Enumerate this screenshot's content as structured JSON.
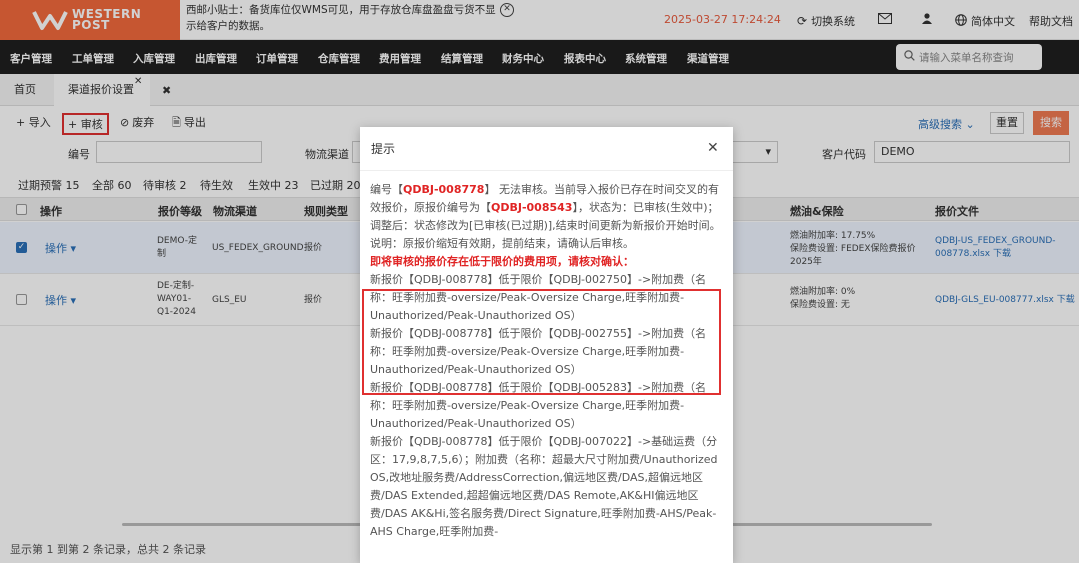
{
  "brand": {
    "logo_line1": "WESTERN",
    "logo_line2": "POST"
  },
  "header": {
    "tip": "西邮小贴士：备货库位仅WMS可见，用于存放仓库盘盈盘亏货不显示给客户的数据。",
    "datetime": "2025-03-27 17:24:24",
    "switch_system": "切换系统",
    "language": "简体中文",
    "help": "帮助文档"
  },
  "nav": {
    "items": [
      "客户管理",
      "工单管理",
      "入库管理",
      "出库管理",
      "订单管理",
      "仓库管理",
      "费用管理",
      "结算管理",
      "财务中心",
      "报表中心",
      "系统管理",
      "渠道管理"
    ],
    "search_placeholder": "请输入菜单名称查询"
  },
  "tabs": [
    {
      "label": "首页"
    },
    {
      "label": "渠道报价设置"
    }
  ],
  "toolbar": {
    "import": "+ 导入",
    "audit": "+ 审核",
    "void": "废弃",
    "export": "导出",
    "advanced_search": "高级搜索",
    "reset": "重置",
    "search": "搜索"
  },
  "filters": {
    "code_label": "编号",
    "channel_label": "物流渠道",
    "customer_label": "客户代码",
    "customer_value": "DEMO"
  },
  "status_tabs": [
    "过期预警 15",
    "全部 60",
    "待审核 2",
    "待生效",
    "生效中 23",
    "已过期 20"
  ],
  "table": {
    "headers": [
      "操作",
      "报价等级",
      "物流渠道",
      "规则类型",
      "燃油&保险",
      "报价文件"
    ],
    "rows": [
      {
        "op": "操作",
        "level": "DEMO-定制",
        "channel": "US_FEDEX_GROUND",
        "rule": "报价",
        "fuel_line1": "燃油附加率: 17.75%",
        "fuel_line2": "保险费设置: FEDEX保险费报价2025年",
        "file": "QDBJ-US_FEDEX_GROUND-008778.xlsx",
        "download": "下载"
      },
      {
        "op": "操作",
        "level": "DE-定制-WAY01-Q1-2024",
        "channel": "GLS_EU",
        "rule": "报价",
        "fuel_line1": "燃油附加率: 0%",
        "fuel_line2": "保险费设置: 无",
        "file": "QDBJ-GLS_EU-008777.xlsx",
        "download": "下载"
      }
    ]
  },
  "footer": "显示第 1 到第 2 条记录，总共 2 条记录",
  "modal": {
    "title": "提示",
    "p1_a": "编号【",
    "p1_code": "QDBJ-008778",
    "p1_b": "】 无法审核。当前导入报价已存在时间交叉的有效报价，原报价编号为【",
    "p1_orig": "QDBJ-008543",
    "p1_c": "】，状态为：已审核(生效中)；调整后：状态修改为[已审核(已过期)],结束时间更新为新报价开始时间。说明：原报价缩短有效期，提前结束，请确认后审核。",
    "warning": "即将审核的报价存在低于限价的费用项，请核对确认：",
    "items": [
      "新报价【QDBJ-008778】低于限价【QDBJ-002750】->附加费（名称：旺季附加费-oversize/Peak-Oversize Charge,旺季附加费-Unauthorized/Peak-Unauthorized OS）",
      "新报价【QDBJ-008778】低于限价【QDBJ-002755】->附加费（名称：旺季附加费-oversize/Peak-Oversize Charge,旺季附加费-Unauthorized/Peak-Unauthorized OS）",
      "新报价【QDBJ-008778】低于限价【QDBJ-005283】->附加费（名称：旺季附加费-oversize/Peak-Oversize Charge,旺季附加费-Unauthorized/Peak-Unauthorized OS）",
      "新报价【QDBJ-008778】低于限价【QDBJ-007022】->基础运费（分区：17,9,8,7,5,6）；附加费（名称：超最大尺寸附加费/Unauthorized OS,改地址服务费/AddressCorrection,偏远地区费/DAS,超偏远地区费/DAS Extended,超超偏远地区费/DAS Remote,AK&HI偏远地区费/DAS AK&Hi,签名服务费/Direct Signature,旺季附加费-AHS/Peak-AHS Charge,旺季附加费-"
    ]
  },
  "colors": {
    "brand": "#f26a3c",
    "nav_bg": "#1f1f1f",
    "link": "#2a6fb8",
    "alert": "#e02424"
  }
}
